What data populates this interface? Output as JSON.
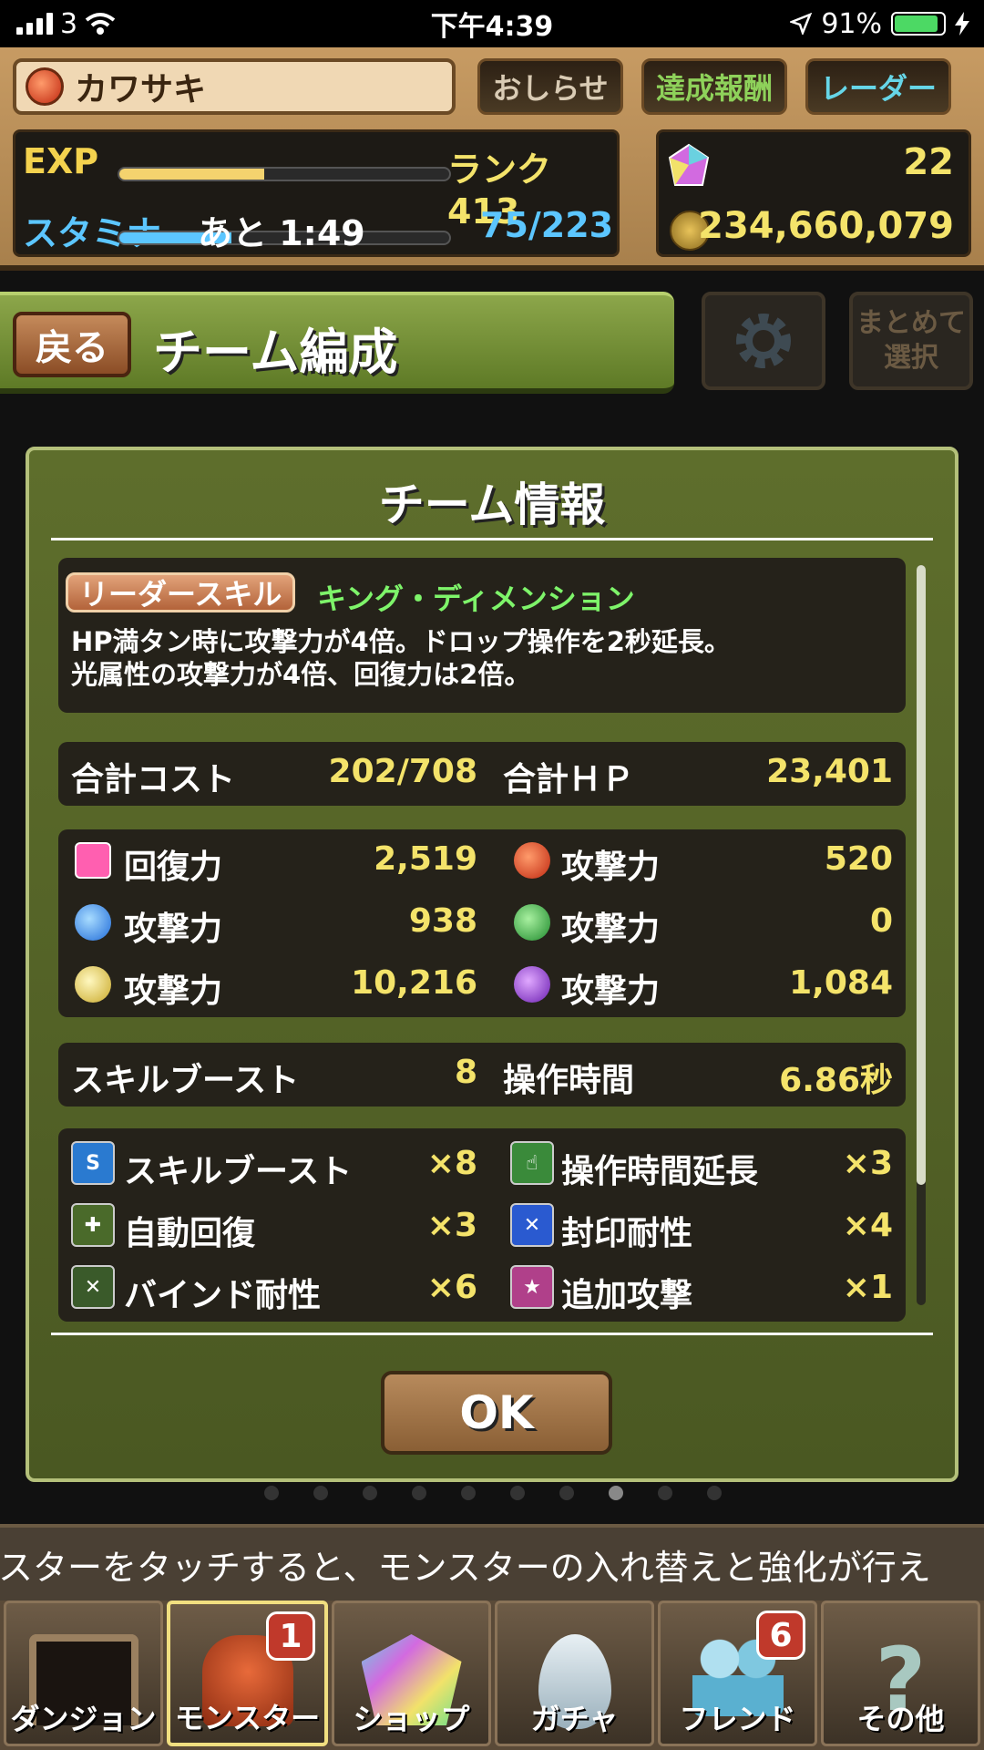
{
  "status_bar": {
    "carrier": "3",
    "time": "下午4:39",
    "battery": "91%"
  },
  "player": {
    "name": "カワサキ",
    "exp_label": "EXP",
    "rank": "ランク 413",
    "stamina_label": "スタミナ",
    "stamina_timer": "あと 1:49",
    "stamina_value": "75/223",
    "stones": "22",
    "coins": "234,660,079"
  },
  "header_buttons": {
    "news": "おしらせ",
    "rewards": "達成報酬",
    "radar": "レーダー"
  },
  "screen": {
    "back": "戻る",
    "title": "チーム編成",
    "select": "まとめて\n選択"
  },
  "dialog": {
    "title": "チーム情報",
    "leader_skill_tag": "リーダースキル",
    "leader_skill_name": "キング・ディメンション",
    "leader_skill_desc_1": "HP満タン時に攻撃力が4倍。ドロップ操作を2秒延長。",
    "leader_skill_desc_2": "光属性の攻撃力が4倍、回復力は2倍。",
    "total_cost_label": "合計コスト",
    "total_cost": "202/708",
    "total_hp_label": "合計ＨＰ",
    "total_hp": "23,401",
    "stats": [
      {
        "label": "回復力",
        "value": "2,519",
        "color": "#ff5fb0"
      },
      {
        "label": "攻撃力",
        "value": "520",
        "color": "#e2502c"
      },
      {
        "label": "攻撃力",
        "value": "938",
        "color": "#3a8fe8"
      },
      {
        "label": "攻撃力",
        "value": "0",
        "color": "#3cae4a"
      },
      {
        "label": "攻撃力",
        "value": "10,216",
        "color": "#f0d94a"
      },
      {
        "label": "攻撃力",
        "value": "1,084",
        "color": "#9b4bd0"
      }
    ],
    "skill_boost_label": "スキルブースト",
    "skill_boost": "8",
    "move_time_label": "操作時間",
    "move_time": "6.86秒",
    "awakenings": [
      {
        "label": "スキルブースト",
        "count": "×8",
        "icon": "skill-boost-icon"
      },
      {
        "label": "操作時間延長",
        "count": "×3",
        "icon": "time-extend-icon"
      },
      {
        "label": "自動回復",
        "count": "×3",
        "icon": "auto-recover-icon"
      },
      {
        "label": "封印耐性",
        "count": "×4",
        "icon": "seal-resist-icon"
      },
      {
        "label": "バインド耐性",
        "count": "×6",
        "icon": "bind-resist-icon"
      },
      {
        "label": "追加攻撃",
        "count": "×1",
        "icon": "extra-attack-icon"
      }
    ],
    "ok": "OK"
  },
  "ticker": "スターをタッチすると、モンスターの入れ替えと強化が行え",
  "tabs": [
    {
      "label": "ダンジョン",
      "badge": ""
    },
    {
      "label": "モンスター",
      "badge": "1"
    },
    {
      "label": "ショップ",
      "badge": ""
    },
    {
      "label": "ガチャ",
      "badge": ""
    },
    {
      "label": "フレンド",
      "badge": "6"
    },
    {
      "label": "その他",
      "badge": ""
    }
  ]
}
